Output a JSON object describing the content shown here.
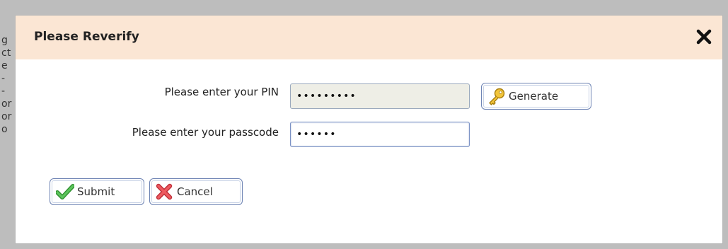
{
  "background": {
    "fragments": [
      "g",
      "ct",
      "e",
      "-",
      "-",
      "or",
      "or",
      "o"
    ]
  },
  "dialog": {
    "title": "Please Reverify",
    "close_icon": "close-icon"
  },
  "form": {
    "pin": {
      "label": "Please enter your PIN",
      "value": "•••••••••"
    },
    "passcode": {
      "label": "Please enter your passcode",
      "value": "••••••"
    }
  },
  "buttons": {
    "generate_label": "Generate",
    "generate_icon": "key-icon",
    "submit_label": "Submit",
    "submit_icon": "checkmark-icon",
    "cancel_label": "Cancel",
    "cancel_icon": "x-cancel-icon"
  },
  "colors": {
    "header_bg": "#fbe6d4",
    "check_green": "#3aa63a",
    "cancel_red": "#e0454a",
    "key_gold": "#e6b81e"
  }
}
